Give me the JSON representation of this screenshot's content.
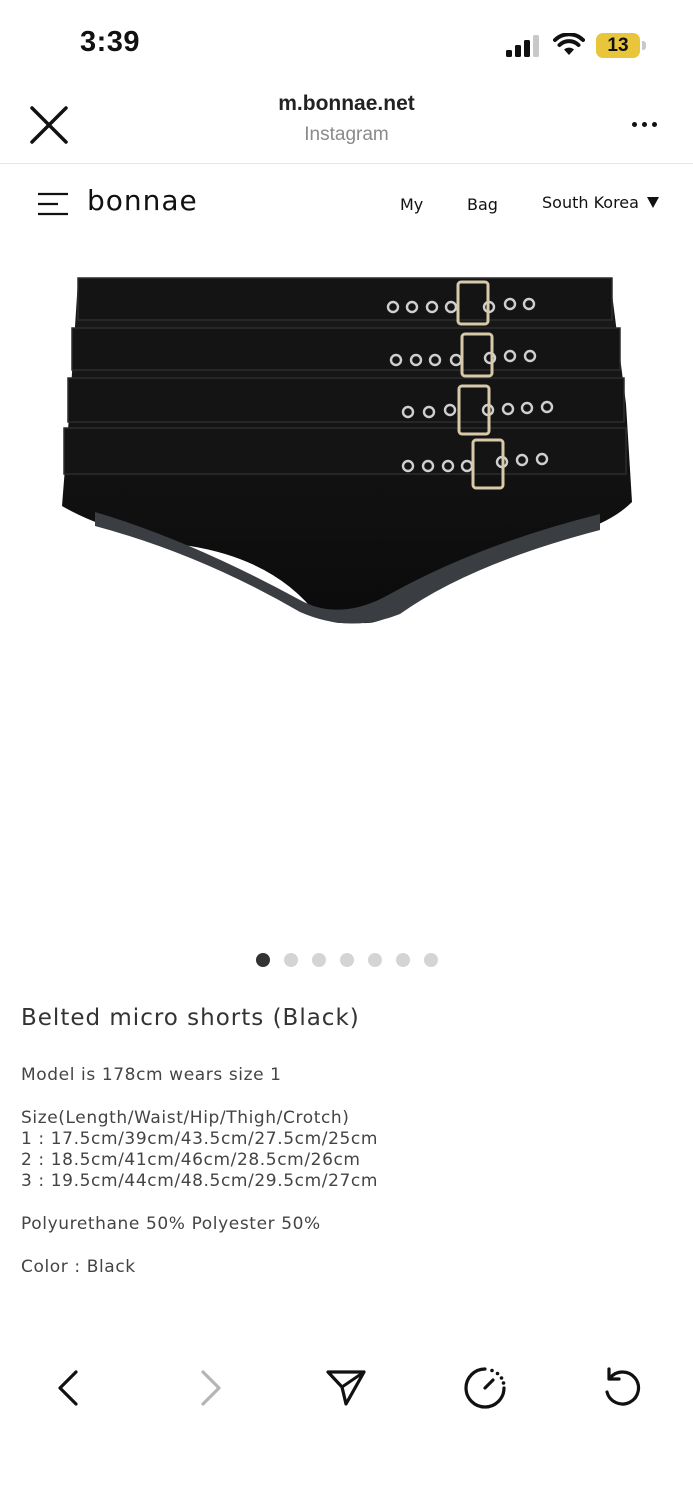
{
  "status_bar": {
    "time": "3:39",
    "battery": "13",
    "battery_color": "#e8c53a",
    "signal_icon": "signal-bars-icon",
    "wifi_icon": "wifi-icon"
  },
  "browser": {
    "url": "m.bonnae.net",
    "source": "Instagram",
    "close_icon": "close-icon",
    "more_icon": "more-icon"
  },
  "site_nav": {
    "logo": "bonnae",
    "menu_icon": "hamburger-menu-icon",
    "my_label": "My",
    "bag_label": "Bag",
    "country_label": "South Korea"
  },
  "gallery": {
    "image_alt": "black belted micro shorts with four buckled straps",
    "total_images": 7,
    "active_index": 1
  },
  "product": {
    "title": "Belted micro shorts (Black)",
    "model_info": "Model is 178cm wears size 1",
    "size_header": "Size(Length/Waist/Hip/Thigh/Crotch)",
    "sizes": [
      "1 : 17.5cm/39cm/43.5cm/27.5cm/25cm",
      "2 : 18.5cm/41cm/46cm/28.5cm/26cm",
      "3 : 19.5cm/44cm/48.5cm/29.5cm/27cm"
    ],
    "material": "Polyurethane 50% Polyester 50%",
    "color": "Color : Black"
  },
  "toolbar": {
    "back_icon": "back-arrow-icon",
    "forward_icon": "forward-arrow-icon",
    "share_icon": "send-icon",
    "speed_icon": "speedometer-icon",
    "refresh_icon": "refresh-icon"
  }
}
